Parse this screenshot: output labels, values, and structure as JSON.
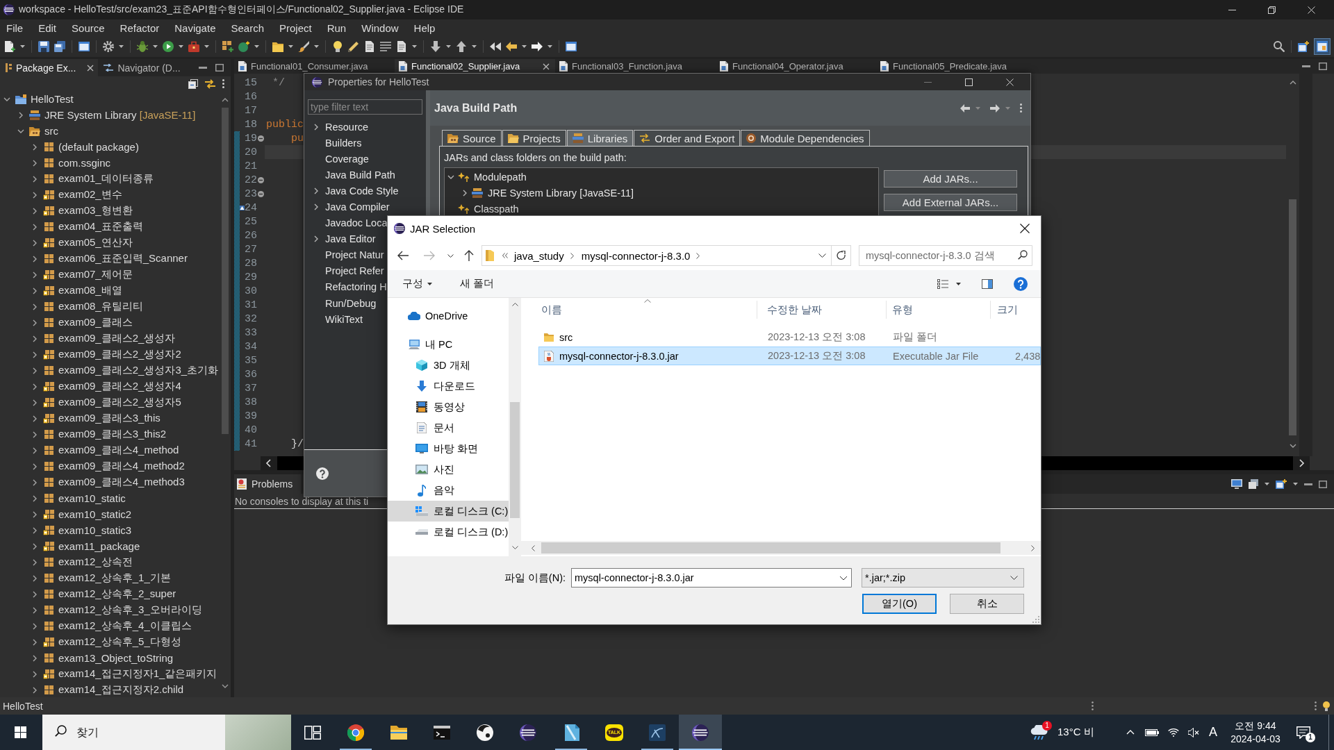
{
  "window": {
    "title": "workspace - HelloTest/src/exam23_표준API함수형인터페이스/Functional02_Supplier.java - Eclipse IDE"
  },
  "menu": [
    "File",
    "Edit",
    "Source",
    "Refactor",
    "Navigate",
    "Search",
    "Project",
    "Run",
    "Window",
    "Help"
  ],
  "package_explorer": {
    "tabs": [
      {
        "kind": "packages",
        "label": "Package Ex...",
        "selected": true
      },
      {
        "kind": "navigator",
        "label": "Navigator (D...",
        "selected": false
      }
    ],
    "tree": [
      {
        "kind": "project",
        "label": "HelloTest",
        "expanded": true,
        "children": [
          {
            "kind": "library",
            "label": "JRE System Library",
            "decoration": "[JavaSE-11]",
            "expanded": false
          },
          {
            "kind": "source-folder",
            "label": "src",
            "expanded": true,
            "children": [
              {
                "kind": "package",
                "label": "(default package)",
                "expanded": false
              },
              {
                "kind": "package",
                "label": "com.ssginc",
                "expanded": false
              },
              {
                "kind": "package",
                "label": "exam01_데이터종류",
                "expanded": false
              },
              {
                "kind": "package-decorated",
                "label": "exam02_변수",
                "expanded": false
              },
              {
                "kind": "package-decorated",
                "label": "exam03_형변환",
                "expanded": false
              },
              {
                "kind": "package",
                "label": "exam04_표준출력",
                "expanded": false
              },
              {
                "kind": "package-decorated",
                "label": "exam05_연산자",
                "expanded": false
              },
              {
                "kind": "package",
                "label": "exam06_표준입력_Scanner",
                "expanded": false
              },
              {
                "kind": "package-decorated",
                "label": "exam07_제어문",
                "expanded": false
              },
              {
                "kind": "package-decorated",
                "label": "exam08_배열",
                "expanded": false
              },
              {
                "kind": "package",
                "label": "exam08_유틸리티",
                "expanded": false
              },
              {
                "kind": "package",
                "label": "exam09_클래스",
                "expanded": false
              },
              {
                "kind": "package",
                "label": "exam09_클래스2_생성자",
                "expanded": false
              },
              {
                "kind": "package-decorated",
                "label": "exam09_클래스2_생성자2",
                "expanded": false
              },
              {
                "kind": "package",
                "label": "exam09_클래스2_생성자3_초기화",
                "expanded": false
              },
              {
                "kind": "package-decorated",
                "label": "exam09_클래스2_생성자4",
                "expanded": false
              },
              {
                "kind": "package-decorated",
                "label": "exam09_클래스2_생성자5",
                "expanded": false
              },
              {
                "kind": "package-decorated",
                "label": "exam09_클래스3_this",
                "expanded": false
              },
              {
                "kind": "package",
                "label": "exam09_클래스3_this2",
                "expanded": false
              },
              {
                "kind": "package",
                "label": "exam09_클래스4_method",
                "expanded": false
              },
              {
                "kind": "package",
                "label": "exam09_클래스4_method2",
                "expanded": false
              },
              {
                "kind": "package",
                "label": "exam09_클래스4_method3",
                "expanded": false
              },
              {
                "kind": "package",
                "label": "exam10_static",
                "expanded": false
              },
              {
                "kind": "package-decorated",
                "label": "exam10_static2",
                "expanded": false
              },
              {
                "kind": "package-decorated",
                "label": "exam10_static3",
                "expanded": false
              },
              {
                "kind": "package-decorated",
                "label": "exam11_package",
                "expanded": false
              },
              {
                "kind": "package",
                "label": "exam12_상속전",
                "expanded": false
              },
              {
                "kind": "package",
                "label": "exam12_상속후_1_기본",
                "expanded": false
              },
              {
                "kind": "package",
                "label": "exam12_상속후_2_super",
                "expanded": false
              },
              {
                "kind": "package",
                "label": "exam12_상속후_3_오버라이딩",
                "expanded": false
              },
              {
                "kind": "package",
                "label": "exam12_상속후_4_이클립스",
                "expanded": false
              },
              {
                "kind": "package-decorated",
                "label": "exam12_상속후_5_다형성",
                "expanded": false
              },
              {
                "kind": "package",
                "label": "exam13_Object_toString",
                "expanded": false
              },
              {
                "kind": "package-decorated",
                "label": "exam14_접근지정자1_같은패키지",
                "expanded": false
              },
              {
                "kind": "package",
                "label": "exam14_접근지정자2.child",
                "expanded": false
              }
            ]
          }
        ]
      }
    ]
  },
  "editor": {
    "tabs": [
      {
        "label": "Functional01_Consumer.java",
        "selected": false
      },
      {
        "label": "Functional02_Supplier.java",
        "selected": true
      },
      {
        "label": "Functional03_Function.java",
        "selected": false
      },
      {
        "label": "Functional04_Operator.java",
        "selected": false
      },
      {
        "label": "Functional05_Predicate.java",
        "selected": false
      }
    ],
    "lines": [
      {
        "number": "15",
        "kind": "comment",
        "code": " */"
      },
      {
        "number": "16",
        "kind": "blank"
      },
      {
        "number": "17",
        "kind": "blank"
      },
      {
        "number": "18",
        "kind": "keyword",
        "code": "public"
      },
      {
        "number": "19",
        "kind": "keyword",
        "code": "    pu",
        "fold": true,
        "changed": true
      },
      {
        "number": "20",
        "kind": "blank",
        "changed": true,
        "current": true
      },
      {
        "number": "21",
        "kind": "blank",
        "changed": true
      },
      {
        "number": "22",
        "kind": "blank",
        "fold": true,
        "changed": true
      },
      {
        "number": "23",
        "kind": "blank",
        "fold": true,
        "changed": true
      },
      {
        "number": "24",
        "kind": "blank",
        "changed": true,
        "marker": true
      },
      {
        "number": "25",
        "kind": "blank",
        "changed": true
      },
      {
        "number": "26",
        "kind": "blank",
        "changed": true
      },
      {
        "number": "27",
        "kind": "blank",
        "changed": true
      },
      {
        "number": "28",
        "kind": "blank",
        "changed": true
      },
      {
        "number": "29",
        "kind": "blank",
        "changed": true
      },
      {
        "number": "30",
        "kind": "blank",
        "changed": true
      },
      {
        "number": "31",
        "kind": "blank",
        "changed": true
      },
      {
        "number": "32",
        "kind": "blank",
        "changed": true
      },
      {
        "number": "33",
        "kind": "blank",
        "changed": true
      },
      {
        "number": "34",
        "kind": "blank",
        "changed": true
      },
      {
        "number": "35",
        "kind": "blank",
        "changed": true
      },
      {
        "number": "36",
        "kind": "blank",
        "changed": true
      },
      {
        "number": "37",
        "kind": "blank",
        "changed": true
      },
      {
        "number": "38",
        "kind": "blank",
        "changed": true
      },
      {
        "number": "39",
        "kind": "blank",
        "changed": true
      },
      {
        "number": "40",
        "kind": "blank",
        "changed": true
      },
      {
        "number": "41",
        "kind": "plain",
        "code": "    }/",
        "changed": true
      }
    ]
  },
  "console": {
    "tab": "Problems",
    "message": "No consoles to display at this ti"
  },
  "properties_dialog": {
    "title": "Properties for HelloTest",
    "filter": {
      "placeholder": "type filter text"
    },
    "pages": [
      {
        "label": "Resource",
        "expanded": false
      },
      {
        "label": "Builders"
      },
      {
        "label": "Coverage"
      },
      {
        "label": "Java Build Path"
      },
      {
        "label": "Java Code Style",
        "expanded": false
      },
      {
        "label": "Java Compiler",
        "expanded": false
      },
      {
        "label": "Javadoc Loca"
      },
      {
        "label": "Java Editor",
        "expanded": false
      },
      {
        "label": "Project Natur"
      },
      {
        "label": "Project Refer"
      },
      {
        "label": "Refactoring H"
      },
      {
        "label": "Run/Debug"
      },
      {
        "label": "WikiText"
      }
    ],
    "page_title": "Java Build Path",
    "tabs": [
      {
        "kind": "source",
        "label": "Source",
        "selected": false
      },
      {
        "kind": "projects",
        "label": "Projects",
        "selected": false
      },
      {
        "kind": "libraries",
        "label": "Libraries",
        "selected": true
      },
      {
        "kind": "order",
        "label": "Order and Export",
        "selected": false
      },
      {
        "kind": "modules",
        "label": "Module Dependencies",
        "selected": false
      }
    ],
    "list_label": "JARs and class folders on the build path:",
    "entries": [
      {
        "kind": "container",
        "label": "Modulepath",
        "expanded": true,
        "children": [
          {
            "kind": "library",
            "label": "JRE System Library [JavaSE-11]",
            "expanded": false
          }
        ]
      },
      {
        "kind": "container",
        "label": "Classpath"
      }
    ],
    "buttons": [
      "Add JARs...",
      "Add External JARs..."
    ]
  },
  "jar_dialog": {
    "title": "JAR Selection",
    "path": [
      "java_study",
      "mysql-connector-j-8.3.0"
    ],
    "search": {
      "placeholder": "mysql-connector-j-8.3.0 검색"
    },
    "commands": [
      {
        "kind": "menu",
        "label": "구성"
      },
      {
        "kind": "button",
        "label": "새 폴더"
      }
    ],
    "nav": [
      {
        "kind": "cloud",
        "label": "OneDrive",
        "selected": false
      },
      {
        "kind": "computer",
        "label": "내 PC",
        "selected": false,
        "children": [
          {
            "kind": "cube",
            "label": "3D 개체",
            "selected": false
          },
          {
            "kind": "download",
            "label": "다운로드",
            "selected": false
          },
          {
            "kind": "video",
            "label": "동영상",
            "selected": false
          },
          {
            "kind": "document",
            "label": "문서",
            "selected": false
          },
          {
            "kind": "desktop",
            "label": "바탕 화면",
            "selected": false
          },
          {
            "kind": "picture",
            "label": "사진",
            "selected": false
          },
          {
            "kind": "music",
            "label": "음악",
            "selected": false
          },
          {
            "kind": "system-drive",
            "label": "로컬 디스크 (C:)",
            "selected": true
          },
          {
            "kind": "drive",
            "label": "로컬 디스크 (D:)",
            "selected": false
          }
        ]
      }
    ],
    "columns": [
      {
        "label": "이름",
        "sorted": true
      },
      {
        "label": "수정한 날짜"
      },
      {
        "label": "유형"
      },
      {
        "label": "크기"
      }
    ],
    "files": [
      {
        "kind": "folder",
        "name": "src",
        "modified": "2023-12-13 오전 3:08",
        "type": "파일 폴더",
        "selected": false
      },
      {
        "kind": "jar",
        "name": "mysql-connector-j-8.3.0.jar",
        "modified": "2023-12-13 오전 3:08",
        "type": "Executable Jar File",
        "size": "2,438",
        "selected": true
      }
    ],
    "file_name_label": "파일 이름(N):",
    "file_name": "mysql-connector-j-8.3.0.jar",
    "file_type": "*.jar;*.zip",
    "buttons": [
      {
        "label": "열기(O)",
        "default": true
      },
      {
        "label": "취소",
        "default": false
      }
    ]
  },
  "status_bar": {
    "text": "HelloTest"
  },
  "taskbar": {
    "search": {
      "placeholder": "찾기"
    },
    "apps": [
      {
        "kind": "task-view",
        "selected": false
      },
      {
        "kind": "chrome",
        "running": true,
        "selected": false
      },
      {
        "kind": "explorer",
        "selected": false
      },
      {
        "kind": "terminal",
        "selected": false
      },
      {
        "kind": "mascot",
        "selected": false
      },
      {
        "kind": "eclipse",
        "selected": false
      },
      {
        "kind": "notebook",
        "running": true,
        "selected": false
      },
      {
        "kind": "chat",
        "label": "TALK",
        "selected": false
      },
      {
        "kind": "workbench",
        "running": true,
        "selected": false
      },
      {
        "kind": "eclipse",
        "running": true,
        "selected": true
      }
    ],
    "weather": {
      "text": "13°C 비",
      "badge": "1"
    },
    "ime": "A",
    "clock": {
      "time": "오전 9:44",
      "date": "2024-04-03"
    },
    "notifications": {
      "badge": "1"
    }
  }
}
